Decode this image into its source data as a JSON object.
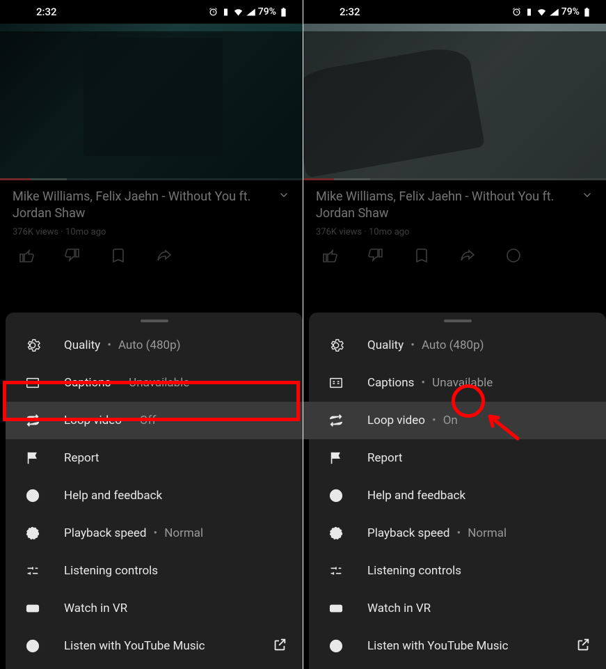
{
  "status": {
    "time": "2:32",
    "battery": "79%"
  },
  "video": {
    "title": "Mike Williams, Felix Jaehn - Without You ft. Jordan Shaw",
    "views": "376K views",
    "sep": " · ",
    "age": "10mo ago"
  },
  "menu": {
    "quality_label": "Quality",
    "quality_value": "Auto (480p)",
    "captions_label": "Captions",
    "captions_value": "Unavailable",
    "loop_label": "Loop video",
    "loop_off": "Off",
    "loop_on": "On",
    "report_label": "Report",
    "help_label": "Help and feedback",
    "speed_label": "Playback speed",
    "speed_value": "Normal",
    "listening_label": "Listening controls",
    "vr_label": "Watch in VR",
    "ytmusic_label": "Listen with YouTube Music"
  }
}
